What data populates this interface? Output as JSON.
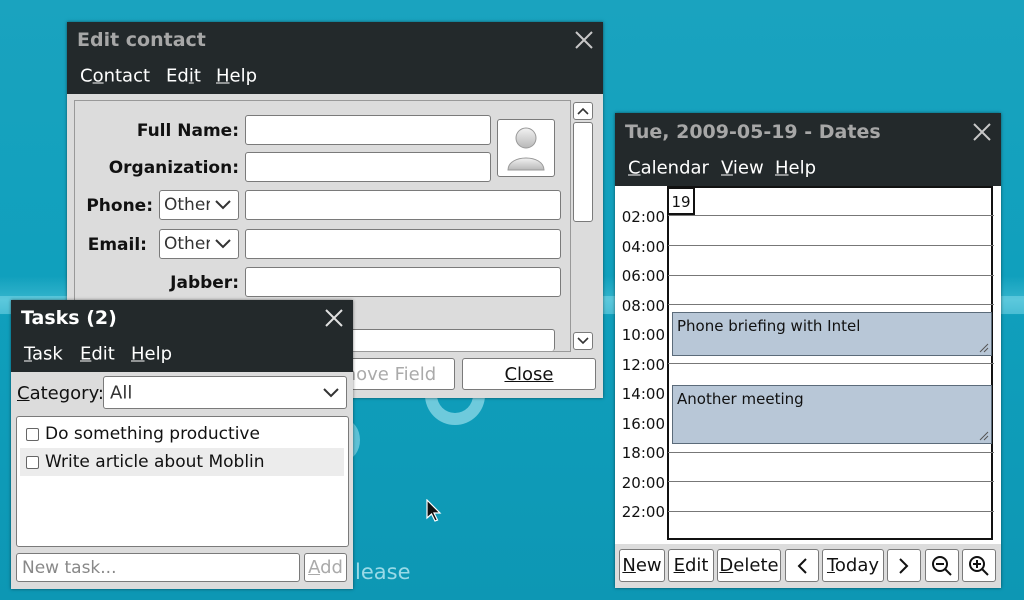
{
  "desktop": {
    "background_text": "lease"
  },
  "edit_contact": {
    "title": "Edit contact",
    "menus": [
      {
        "pre": "C",
        "u": "o",
        "post": "ntact"
      },
      {
        "pre": "Ed",
        "u": "i",
        "post": "t"
      },
      {
        "pre": "",
        "u": "H",
        "post": "elp"
      }
    ],
    "labels": {
      "full_name": "Full Name:",
      "organization": "Organization:",
      "phone": "Phone:",
      "email": "Email:",
      "jabber": "Jabber:"
    },
    "phone_type": "Other",
    "email_type": "Other",
    "remove_field": "Remove Field",
    "close": "Close"
  },
  "tasks": {
    "title": "Tasks (2)",
    "menus": [
      {
        "pre": "",
        "u": "T",
        "post": "ask"
      },
      {
        "pre": "",
        "u": "E",
        "post": "dit"
      },
      {
        "pre": "",
        "u": "H",
        "post": "elp"
      }
    ],
    "category_label_u": "C",
    "category_label_rest": "ategory:",
    "category_value": "All",
    "items": [
      {
        "text": "Do something productive",
        "checked": false
      },
      {
        "text": "Write article about Moblin",
        "checked": false
      }
    ],
    "new_task_placeholder": "New task...",
    "add_u": "A",
    "add_rest": "dd"
  },
  "dates": {
    "title": "Tue, 2009-05-19 - Dates",
    "menus": [
      {
        "pre": "",
        "u": "C",
        "post": "alendar"
      },
      {
        "pre": "",
        "u": "V",
        "post": "iew"
      },
      {
        "pre": "",
        "u": "H",
        "post": "elp"
      }
    ],
    "day_number": "19",
    "hours": [
      "02:00",
      "04:00",
      "06:00",
      "08:00",
      "10:00",
      "12:00",
      "14:00",
      "16:00",
      "18:00",
      "20:00",
      "22:00"
    ],
    "events": [
      {
        "title": "Phone briefing with Intel"
      },
      {
        "title": "Another meeting"
      }
    ],
    "toolbar": {
      "new_u": "N",
      "new_rest": "ew",
      "edit_u": "E",
      "edit_rest": "dit",
      "delete_u": "D",
      "delete_rest": "elete",
      "today_u": "T",
      "today_rest": "oday"
    }
  }
}
